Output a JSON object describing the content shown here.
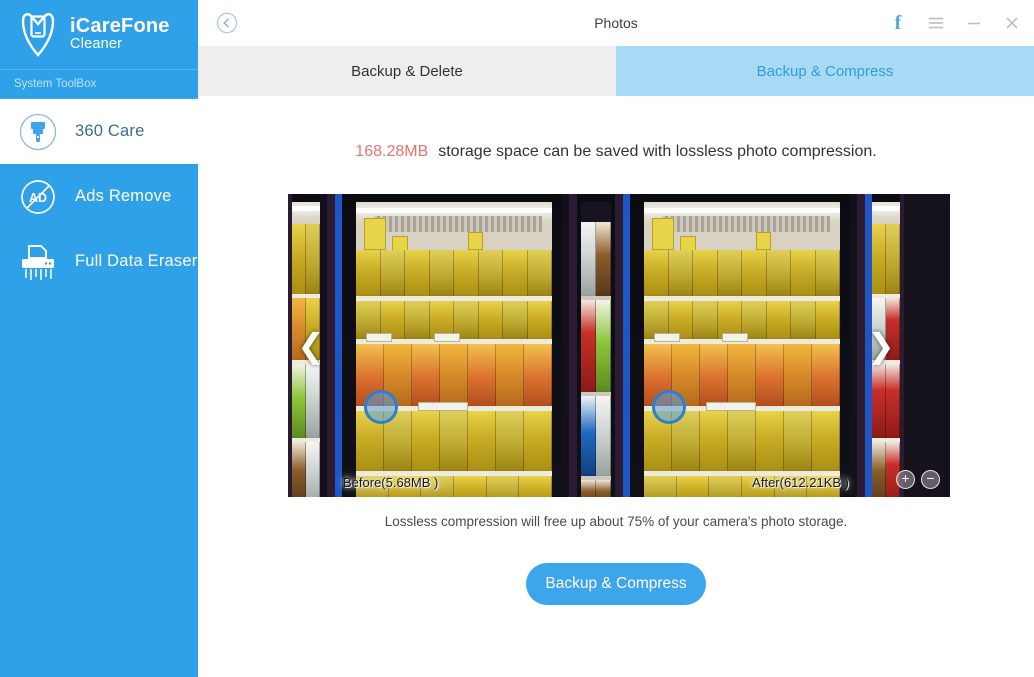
{
  "sidebar": {
    "brand_name": "iCareFone",
    "brand_sub": "Cleaner",
    "brand_logo_icon": "phone-pin-icon",
    "section_label": "System ToolBox",
    "items": [
      {
        "label": "360 Care",
        "icon": "paintbrush-circle-icon",
        "active": true
      },
      {
        "label": "Ads Remove",
        "icon": "ad-block-circle-icon",
        "active": false
      },
      {
        "label": "Full Data Eraser",
        "icon": "shredder-icon",
        "active": false
      }
    ]
  },
  "titlebar": {
    "back_icon": "back-circle-icon",
    "title": "Photos",
    "facebook_icon": "facebook-f-icon",
    "menu_icon": "hamburger-menu-icon",
    "minimize_icon": "minimize-icon",
    "close_icon": "close-icon",
    "facebook_label": "f",
    "minimize_label": "−",
    "close_label": "×"
  },
  "tabs": [
    {
      "label": "Backup & Delete",
      "active": false
    },
    {
      "label": "Backup & Compress",
      "active": true
    }
  ],
  "content": {
    "save_amount": "168.28MB",
    "save_message": "storage space can be saved with lossless photo compression.",
    "before_label": "Before(5.68MB )",
    "after_label": "After(612.21KB )",
    "prev_arrow": "❮",
    "next_arrow": "❯",
    "zoom_in_label": "+",
    "zoom_out_label": "−",
    "hint": "Lossless compression will free up about 75% of your camera's photo storage.",
    "cta_label": "Backup & Compress"
  },
  "colors": {
    "sidebar_blue": "#2fa1e8",
    "accent_blue": "#3da5ec",
    "tab_active_bg": "#a8daf5",
    "tab_active_text": "#2b9fe0",
    "tab_inactive_bg": "#eeeeee",
    "save_amount_color": "#e8736b"
  }
}
